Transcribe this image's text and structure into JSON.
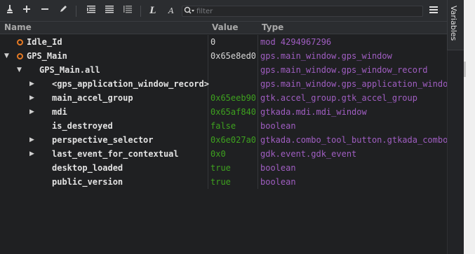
{
  "toolbar": {
    "icons": [
      "broom-icon",
      "plus-icon",
      "minus-icon",
      "pencil-icon",
      "expand-all-icon",
      "collapse-all-icon",
      "outline-icon",
      "italic-l-icon",
      "italic-a-icon",
      "search-icon"
    ],
    "filter_placeholder": "filter",
    "menu_icon": "hamburger-menu-icon"
  },
  "side_tab": {
    "label": "Variables"
  },
  "columns": {
    "name": "Name",
    "value": "Value",
    "type": "Type"
  },
  "rows": [
    {
      "name": "Idle_Id",
      "value": "0",
      "value_color": "white",
      "type": "mod 4294967296",
      "indent": 0,
      "dot": true,
      "arrow": "none"
    },
    {
      "name": "GPS_Main",
      "value": "0x65e8ed0",
      "value_color": "white",
      "type": "gps.main_window.gps_window",
      "indent": 0,
      "dot": true,
      "arrow": "expanded"
    },
    {
      "name": "GPS_Main.all",
      "value": "",
      "value_color": "white",
      "type": "gps.main_window.gps_window_record",
      "indent": 1,
      "dot": false,
      "arrow": "expanded"
    },
    {
      "name": "<gps_application_window_record>",
      "value": "",
      "value_color": "white",
      "type": "gps.main_window.gps_application_window",
      "indent": 2,
      "dot": false,
      "arrow": "collapsed"
    },
    {
      "name": "main_accel_group",
      "value": "0x65eeb90",
      "value_color": "green",
      "type": "gtk.accel_group.gtk_accel_group",
      "indent": 2,
      "dot": false,
      "arrow": "collapsed"
    },
    {
      "name": "mdi",
      "value": "0x65af840",
      "value_color": "green",
      "type": "gtkada.mdi.mdi_window",
      "indent": 2,
      "dot": false,
      "arrow": "collapsed"
    },
    {
      "name": "is_destroyed",
      "value": "false",
      "value_color": "green",
      "type": "boolean",
      "indent": 2,
      "dot": false,
      "arrow": "none"
    },
    {
      "name": "perspective_selector",
      "value": "0x6e027a0",
      "value_color": "green",
      "type": "gtkada.combo_tool_button.gtkada_combo_",
      "indent": 2,
      "dot": false,
      "arrow": "collapsed"
    },
    {
      "name": "last_event_for_contextual",
      "value": "0x0",
      "value_color": "green",
      "type": "gdk.event.gdk_event",
      "indent": 2,
      "dot": false,
      "arrow": "collapsed"
    },
    {
      "name": "desktop_loaded",
      "value": "true",
      "value_color": "green",
      "type": "boolean",
      "indent": 2,
      "dot": false,
      "arrow": "none"
    },
    {
      "name": "public_version",
      "value": "true",
      "value_color": "green",
      "type": "boolean",
      "indent": 2,
      "dot": false,
      "arrow": "none"
    }
  ]
}
